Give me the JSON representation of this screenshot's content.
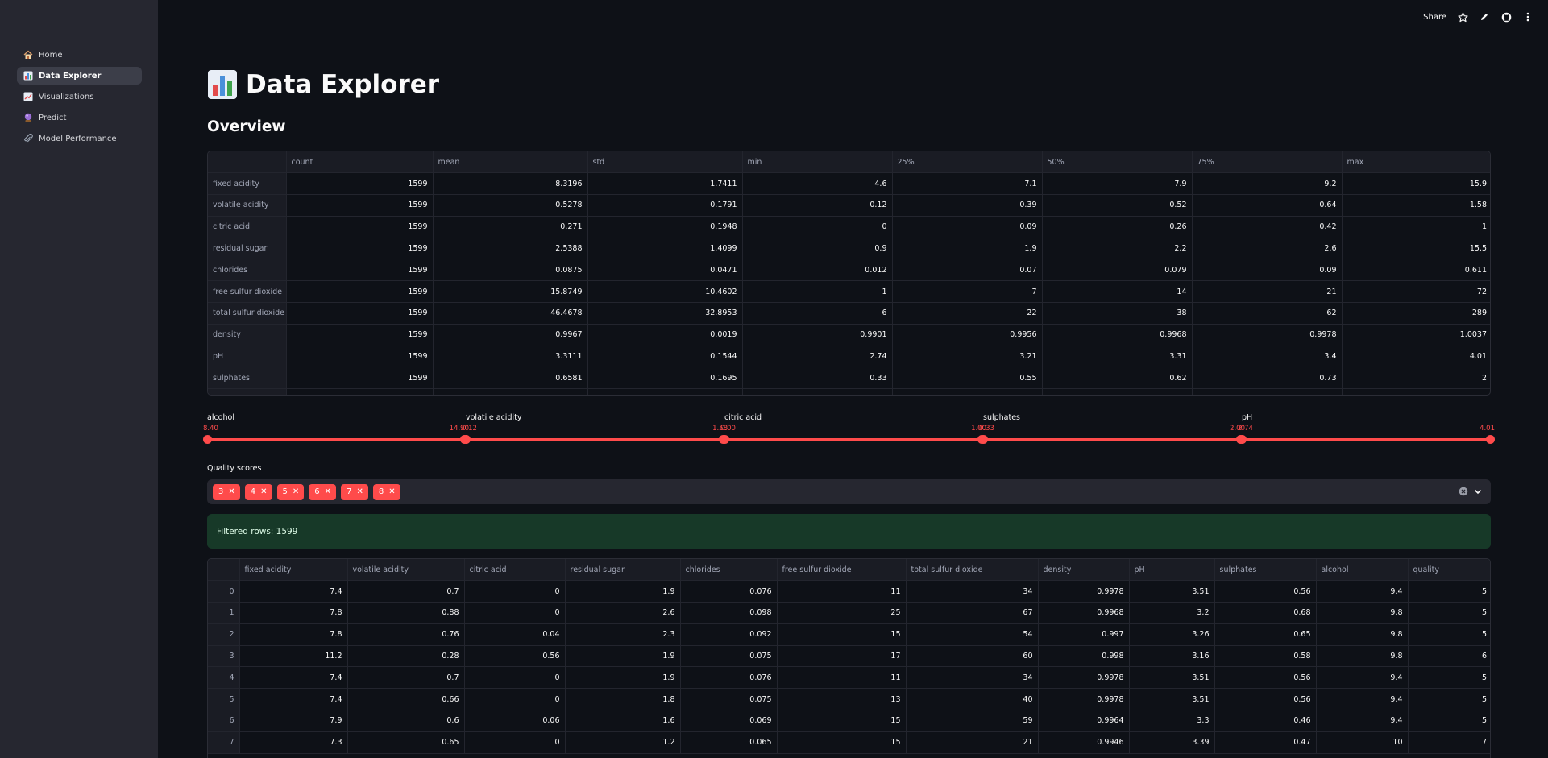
{
  "sidebar": {
    "items": [
      {
        "label": "Home",
        "icon": "house-icon",
        "active": false
      },
      {
        "label": "Data Explorer",
        "icon": "bar-chart-icon",
        "active": true
      },
      {
        "label": "Visualizations",
        "icon": "line-chart-icon",
        "active": false
      },
      {
        "label": "Predict",
        "icon": "crystal-ball-icon",
        "active": false
      },
      {
        "label": "Model Performance",
        "icon": "paperclip-icon",
        "active": false
      }
    ]
  },
  "toolbar": {
    "share_label": "Share"
  },
  "page": {
    "title": "Data Explorer",
    "overview_heading": "Overview"
  },
  "stats_table": {
    "columns": [
      "",
      "count",
      "mean",
      "std",
      "min",
      "25%",
      "50%",
      "75%",
      "max"
    ],
    "rows": [
      [
        "fixed acidity",
        "1599",
        "8.3196",
        "1.7411",
        "4.6",
        "7.1",
        "7.9",
        "9.2",
        "15.9"
      ],
      [
        "volatile acidity",
        "1599",
        "0.5278",
        "0.1791",
        "0.12",
        "0.39",
        "0.52",
        "0.64",
        "1.58"
      ],
      [
        "citric acid",
        "1599",
        "0.271",
        "0.1948",
        "0",
        "0.09",
        "0.26",
        "0.42",
        "1"
      ],
      [
        "residual sugar",
        "1599",
        "2.5388",
        "1.4099",
        "0.9",
        "1.9",
        "2.2",
        "2.6",
        "15.5"
      ],
      [
        "chlorides",
        "1599",
        "0.0875",
        "0.0471",
        "0.012",
        "0.07",
        "0.079",
        "0.09",
        "0.611"
      ],
      [
        "free sulfur dioxide",
        "1599",
        "15.8749",
        "10.4602",
        "1",
        "7",
        "14",
        "21",
        "72"
      ],
      [
        "total sulfur dioxide",
        "1599",
        "46.4678",
        "32.8953",
        "6",
        "22",
        "38",
        "62",
        "289"
      ],
      [
        "density",
        "1599",
        "0.9967",
        "0.0019",
        "0.9901",
        "0.9956",
        "0.9968",
        "0.9978",
        "1.0037"
      ],
      [
        "pH",
        "1599",
        "3.3111",
        "0.1544",
        "2.74",
        "3.21",
        "3.31",
        "3.4",
        "4.01"
      ],
      [
        "sulphates",
        "1599",
        "0.6581",
        "0.1695",
        "0.33",
        "0.55",
        "0.62",
        "0.73",
        "2"
      ],
      [
        "",
        "",
        "",
        "",
        "",
        "",
        "",
        "",
        ""
      ]
    ]
  },
  "sliders": [
    {
      "label": "alcohol",
      "min": "8.40",
      "max": "14.90"
    },
    {
      "label": "volatile acidity",
      "min": "0.12",
      "max": "1.58"
    },
    {
      "label": "citric acid",
      "min": "0.00",
      "max": "1.00"
    },
    {
      "label": "sulphates",
      "min": "0.33",
      "max": "2.00"
    },
    {
      "label": "pH",
      "min": "2.74",
      "max": "4.01"
    }
  ],
  "quality": {
    "label": "Quality scores",
    "selected": [
      "3",
      "4",
      "5",
      "6",
      "7",
      "8"
    ]
  },
  "filtered": {
    "message": "Filtered rows: 1599"
  },
  "preview_table": {
    "columns": [
      "",
      "fixed acidity",
      "volatile acidity",
      "citric acid",
      "residual sugar",
      "chlorides",
      "free sulfur dioxide",
      "total sulfur dioxide",
      "density",
      "pH",
      "sulphates",
      "alcohol",
      "quality"
    ],
    "rows": [
      [
        "0",
        "7.4",
        "0.7",
        "0",
        "1.9",
        "0.076",
        "11",
        "34",
        "0.9978",
        "3.51",
        "0.56",
        "9.4",
        "5"
      ],
      [
        "1",
        "7.8",
        "0.88",
        "0",
        "2.6",
        "0.098",
        "25",
        "67",
        "0.9968",
        "3.2",
        "0.68",
        "9.8",
        "5"
      ],
      [
        "2",
        "7.8",
        "0.76",
        "0.04",
        "2.3",
        "0.092",
        "15",
        "54",
        "0.997",
        "3.26",
        "0.65",
        "9.8",
        "5"
      ],
      [
        "3",
        "11.2",
        "0.28",
        "0.56",
        "1.9",
        "0.075",
        "17",
        "60",
        "0.998",
        "3.16",
        "0.58",
        "9.8",
        "6"
      ],
      [
        "4",
        "7.4",
        "0.7",
        "0",
        "1.9",
        "0.076",
        "11",
        "34",
        "0.9978",
        "3.51",
        "0.56",
        "9.4",
        "5"
      ],
      [
        "5",
        "7.4",
        "0.66",
        "0",
        "1.8",
        "0.075",
        "13",
        "40",
        "0.9978",
        "3.51",
        "0.56",
        "9.4",
        "5"
      ],
      [
        "6",
        "7.9",
        "0.6",
        "0.06",
        "1.6",
        "0.069",
        "15",
        "59",
        "0.9964",
        "3.3",
        "0.46",
        "9.4",
        "5"
      ],
      [
        "7",
        "7.3",
        "0.65",
        "0",
        "1.2",
        "0.065",
        "15",
        "21",
        "0.9946",
        "3.39",
        "0.47",
        "10",
        "7"
      ]
    ]
  },
  "colors": {
    "accent": "#ff4b4b",
    "sidebar_bg": "#262730",
    "main_bg": "#0e1117",
    "success_bg": "#173928"
  }
}
